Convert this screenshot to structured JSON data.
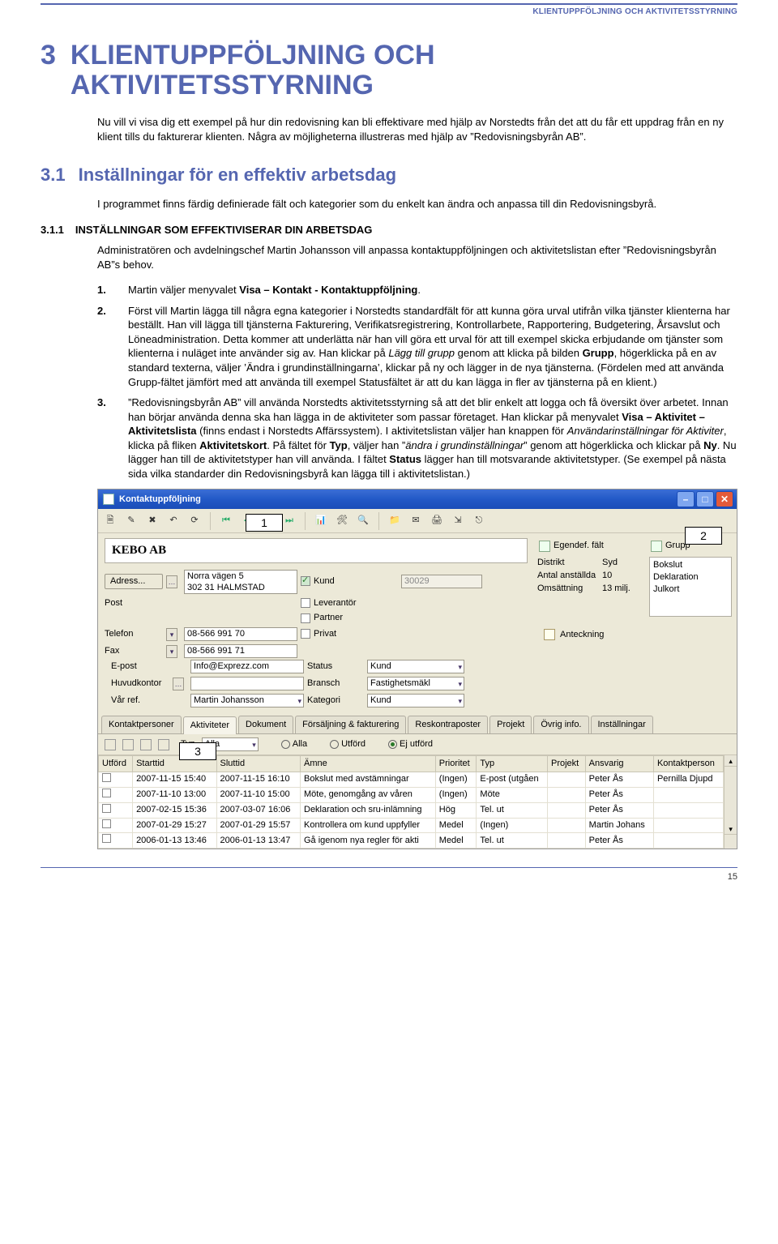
{
  "header_right": "KLIENTUPPFÖLJNING OCH AKTIVITETSSTYRNING",
  "chapter_num": "3",
  "chapter_title": "KLIENTUPPFÖLJNING OCH AKTIVITETSSTYRNING",
  "intro": "Nu vill vi visa dig ett exempel på hur din redovisning kan bli effektivare med hjälp av Norstedts från det att du får ett uppdrag från en ny klient tills du fakturerar klienten. Några av möjligheterna illustreras med hjälp av ”Redovisningsbyrån AB”.",
  "section_num": "3.1",
  "section_title": "Inställningar för en effektiv arbetsdag",
  "section_body": "I programmet finns färdig definierade fält och kategorier som du enkelt kan ändra och anpassa till din Redovisningsbyrå.",
  "subsection_num": "3.1.1",
  "subsection_title": "INSTÄLLNINGAR SOM EFFEKTIVISERAR DIN ARBETSDAG",
  "subsection_body": "Administratören och avdelningschef Martin Johansson vill anpassa kontaktuppföljningen och aktivitetslistan efter ”Redovisningsbyrån AB”s behov.",
  "steps": {
    "s1_num": "1.",
    "s1_a": "Martin väljer menyvalet ",
    "s1_b": "Visa – Kontakt - Kontaktuppföljning",
    "s1_c": ".",
    "s2_num": "2.",
    "s2_a": "Först vill Martin lägga till några egna kategorier i Norstedts standardfält för att kunna göra urval utifrån vilka tjänster klienterna har beställt. Han vill lägga till tjänsterna Fakturering, Verifikatsregistrering, Kontrollarbete, Rapportering, Budgetering, Årsavslut och Löneadministration. Detta kommer att underlätta när han vill göra ett urval för att till exempel skicka erbjudande om tjänster som klienterna i nuläget inte använder sig av. Han klickar på ",
    "s2_b": "Lägg till grupp",
    "s2_c": " genom att klicka på bilden ",
    "s2_d": "Grupp",
    "s2_e": ", högerklicka på en av standard texterna, väljer ’Ändra i grundinställningarna’, klickar på ny och lägger in de nya tjänsterna. (Fördelen med att använda Grupp-fältet jämfört med att använda till exempel Statusfältet är att du kan lägga in fler av tjänsterna på en klient.)",
    "s3_num": "3.",
    "s3_a": "”Redovisningsbyrån AB” vill använda Norstedts aktivitetsstyrning så att det blir enkelt att logga och få översikt över arbetet. Innan han börjar använda denna ska han lägga in de aktiviteter som passar företaget. Han klickar på menyvalet ",
    "s3_b": "Visa – Aktivitet – Aktivitetslista",
    "s3_c": " (finns endast i Norstedts Affärssystem). I aktivitetslistan väljer han knappen för ",
    "s3_d": "Användarinställningar för Aktiviter",
    "s3_e": ", klicka på fliken ",
    "s3_f": "Aktivitetskort",
    "s3_g": ". På fältet för ",
    "s3_h": "Typ",
    "s3_i": ", väljer han ”",
    "s3_j": "ändra i grundinställningar",
    "s3_k": "” genom att högerklicka och klickar på ",
    "s3_l": "Ny",
    "s3_m": ". Nu lägger han till de aktivitetstyper han vill använda. I fältet ",
    "s3_n": "Status",
    "s3_o": " lägger han till motsvarande aktivitetstyper. (Se exempel på nästa sida vilka standarder din Redovisningsbyrå kan lägga till i aktivitetslistan.)"
  },
  "screenshot": {
    "title": "Kontaktuppföljning",
    "callouts": {
      "c1": "1",
      "c2": "2",
      "c3": "3"
    },
    "company": "KEBO AB",
    "panes": {
      "egendef": "Egendef. fält",
      "grupp": "Grupp",
      "distrikt_k": "Distrikt",
      "distrikt_v": "Syd",
      "anst_k": "Antal anställda",
      "anst_v": "10",
      "oms_k": "Omsättning",
      "oms_v": "13 milj.",
      "grupp_items": [
        "Bokslut",
        "Deklaration",
        "Julkort"
      ]
    },
    "form": {
      "adress_btn": "Adress...",
      "adress_val": "Norra vägen 5\n302 31 HALMSTAD",
      "post": "Post",
      "kund": "Kund",
      "kundnr": "30029",
      "lev": "Leverantör",
      "partner": "Partner",
      "privat": "Privat",
      "telefon_lbl": "Telefon",
      "telefon_val": "08-566 991 70",
      "fax_lbl": "Fax",
      "fax_val": "08-566 991 71",
      "epost_lbl": "E-post",
      "epost_val": "Info@Exprezz.com",
      "hk_lbl": "Huvudkontor",
      "ref_lbl": "Vår ref.",
      "ref_val": "Martin Johansson",
      "status_lbl": "Status",
      "status_val": "Kund",
      "bransch_lbl": "Bransch",
      "bransch_val": "Fastighetsmäkl",
      "kategori_lbl": "Kategori",
      "kategori_val": "Kund",
      "anteckning": "Anteckning"
    },
    "tabs": [
      "Kontaktpersoner",
      "Aktiviteter",
      "Dokument",
      "Försäljning & fakturering",
      "Reskontraposter",
      "Projekt",
      "Övrig info.",
      "Inställningar"
    ],
    "tabtools": {
      "typ": "Typ",
      "alla": "Alla",
      "alla2": "Alla",
      "utford": "Utförd",
      "ejutford": "Ej utförd"
    },
    "grid": {
      "headers": [
        "Utförd",
        "Starttid",
        "Sluttid",
        "Ämne",
        "Prioritet",
        "Typ",
        "Projekt",
        "Ansvarig",
        "Kontaktperson"
      ],
      "rows": [
        [
          "",
          "2007-11-15 15:40",
          "2007-11-15 16:10",
          "Bokslut med avstämningar",
          "(Ingen)",
          "E-post (utgåen",
          "",
          "Peter Ås",
          "Pernilla Djupd"
        ],
        [
          "",
          "2007-11-10 13:00",
          "2007-11-10 15:00",
          "Möte, genomgång av våren",
          "(Ingen)",
          "Möte",
          "",
          "Peter Ås",
          ""
        ],
        [
          "",
          "2007-02-15 15:36",
          "2007-03-07 16:06",
          "Deklaration och sru-inlämning",
          "Hög",
          "Tel. ut",
          "",
          "Peter Ås",
          ""
        ],
        [
          "",
          "2007-01-29 15:27",
          "2007-01-29 15:57",
          "Kontrollera om kund uppfyller",
          "Medel",
          "(Ingen)",
          "",
          "Martin Johans",
          ""
        ],
        [
          "",
          "2006-01-13 13:46",
          "2006-01-13 13:47",
          "Gå igenom nya regler för akti",
          "Medel",
          "Tel. ut",
          "",
          "Peter Ås",
          ""
        ]
      ]
    }
  },
  "page_number": "15"
}
